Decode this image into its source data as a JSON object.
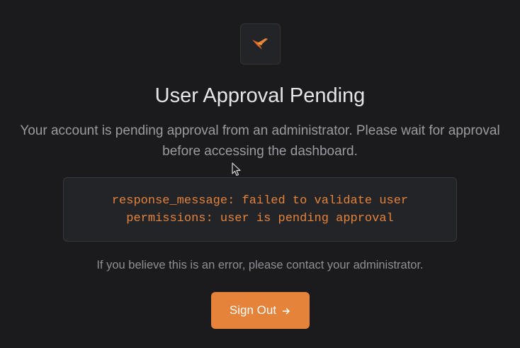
{
  "card": {
    "logo_icon": "brand-bird-logo-icon",
    "title": "User Approval Pending",
    "description": "Your account is pending approval from an administrator. Please wait for approval before accessing the dashboard.",
    "error_message": "response_message: failed to validate user permissions: user is pending approval",
    "help_text": "If you believe this is an error, please contact your administrator.",
    "signout_label": "Sign Out",
    "signout_icon": "arrow-right-icon"
  },
  "colors": {
    "background": "#1b1b1d",
    "accent": "#e5833a",
    "title": "#e6e6e8",
    "muted_text": "#9a9ba0"
  }
}
